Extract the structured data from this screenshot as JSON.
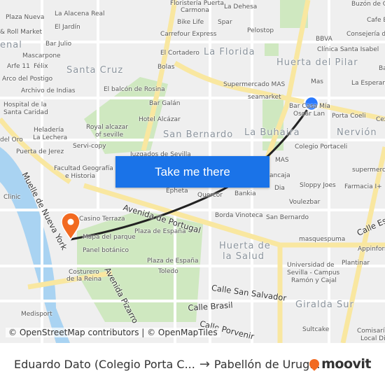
{
  "map": {
    "labels": {
      "plaza_nueva": "Plaza Nueva",
      "alacena": "La Alacena Real",
      "jardin": "El Jardín",
      "roll": "& Roll Market",
      "bar_julio": "Bar Julio",
      "enal": "enal",
      "mascarpone": "Mascarpone",
      "arfe": "Arfe 11",
      "felix": "Félix",
      "santa_cruz": "Santa Cruz",
      "arco": "Arco del Postigo",
      "archivo": "Archivo de Indias",
      "balcon": "El balcón de Rosina",
      "hospital1": "Hospital de la",
      "hospital2": "Santa Caridad",
      "bar_galan": "Bar Galán",
      "hotel": "Hotel Alcázar",
      "royal1": "Royal alcazar",
      "royal2": "of seville",
      "heladeria1": "Heladería",
      "heladeria2": "La Lechera",
      "del_oro": "del Oro",
      "san_bernardo": "San Bernardo",
      "servi": "Servi-copy",
      "puerta_jerez": "Puerta de Jerez",
      "juzgados": "Juzgados de Sevilla",
      "floristeria1": "Floristería Puerta",
      "floristeria2": "Carmona",
      "dehesa": "La Dehesa",
      "bike": "Bike Life",
      "spar": "Spar",
      "carrefour": "Carrefour Express",
      "pelostop": "Pelostop",
      "cortadero": "El Cortadero",
      "florida": "La Florida",
      "bolas": "Bolas",
      "buzon": "Buzón de Co",
      "cafe": "Cafe B",
      "consejeria": "Consejería de",
      "bbva": "BBVA",
      "clinica": "Clínica Santa Isabel",
      "huerta_pilar": "Huerta del Pilar",
      "ba": "Ba",
      "mas1": "Mas",
      "esperanza": "La Esperanza",
      "supermas": "Supermercado MAS",
      "seamarket": "seamarket",
      "bar_casa": "Bar Casa Mía",
      "oscar": "Oscar Lan",
      "porta_coeli": "Porta Coeli",
      "cex": "Cex",
      "buhaira": "La Buhaira",
      "nervion": "Nervión",
      "portaceli": "Colegio Portaceli",
      "mas2": "MAS",
      "supermerca": "supermerca",
      "farmacia": "Farmacia I+",
      "facultad1": "Facultad Geografía",
      "facultad2": "e Historia",
      "clinic": "Clinic",
      "ancaja": "ancaja",
      "epheta": "Epheta",
      "quercor": "Quercor",
      "bankia": "Bankia",
      "dia": "Dia",
      "sloppy": "Sloppy Joes",
      "voulez": "Voulezbar",
      "av_portugal": "Avenida de Portugal",
      "casino": "Casino Terraza",
      "borda": "Borda Vinoteca",
      "san_bernardo2": "San Bernardo",
      "calle_esp": "Calle Esp",
      "masquespuma": "masquespuma",
      "appinforn": "Appinforn",
      "plaza_espana1": "Plaza de España",
      "mapa_parque": "Mapa del parque",
      "panel": "Panel botánico",
      "huerta_salud1": "Huerta de",
      "huerta_salud2": "la Salud",
      "plaza_espana2": "Plaza de España",
      "plantinar": "Plantinar",
      "univ1": "Universidad de",
      "univ2": "Sevilla - Campus",
      "univ3": "Ramón y Cajal",
      "toledo": "Toledo",
      "costurero1": "Costurero",
      "costurero2": "de la Reina",
      "av_pizarro": "Avenida Pizarro",
      "muelle": "Muelle de Nueva York",
      "san_salvador": "Calle San Salvador",
      "brasil": "Calle Brasil",
      "giralda": "Giralda Sur",
      "medisport": "Medisport",
      "porvenir": "Calle Porvenir",
      "sultcake": "Sultcake",
      "comisaria1": "Comisaría",
      "comisaria2": "Local Di"
    },
    "origin_marker_color": "#2979ff",
    "destination_marker_color": "#f26a21",
    "route_color": "#222222"
  },
  "cta": {
    "label": "Take me there",
    "color": "#1a73e8"
  },
  "attribution": "© OpenStreetMap contributors | © OpenMapTiles",
  "footer": {
    "origin": "Eduardo Dato (Colegio Porta C...",
    "arrow": "→",
    "destination": "Pabellón de Urug...",
    "brand": "moovit"
  }
}
